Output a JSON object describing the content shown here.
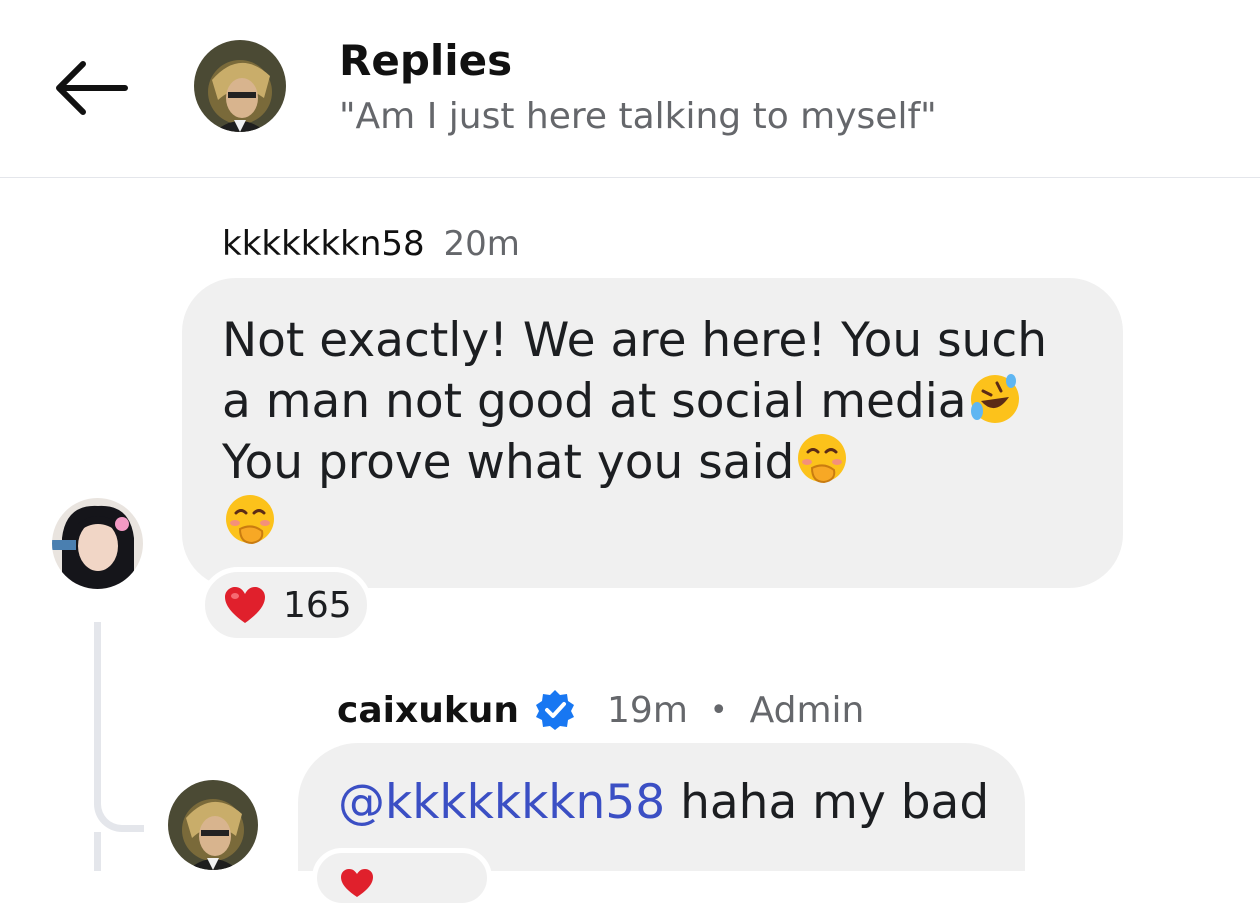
{
  "header": {
    "back_icon": "back-arrow-icon",
    "title": "Replies",
    "subtitle": "\"Am I just here talking to myself\""
  },
  "comment": {
    "username": "kkkkkkkn58",
    "time": "20m",
    "text_part1": "Not exactly!  We are here!  You such a man not good at social media",
    "text_part2": "You prove what you said",
    "emojis": [
      "rolling-on-floor-laughing-emoji",
      "face-with-hand-over-mouth-emoji",
      "face-with-hand-over-mouth-emoji"
    ],
    "reaction_icon": "heart-icon",
    "reaction_count": "165"
  },
  "reply": {
    "username": "caixukun",
    "verified_icon": "verified-badge-icon",
    "time": "19m",
    "separator": "•",
    "role": "Admin",
    "mention": "@kkkkkkkn58",
    "text": " haha my bad"
  },
  "colors": {
    "bubble": "#f0f0f0",
    "mention": "#3b4fc4",
    "secondary_text": "#65676b",
    "verified": "#1877f2",
    "heart": "#e0202c"
  }
}
